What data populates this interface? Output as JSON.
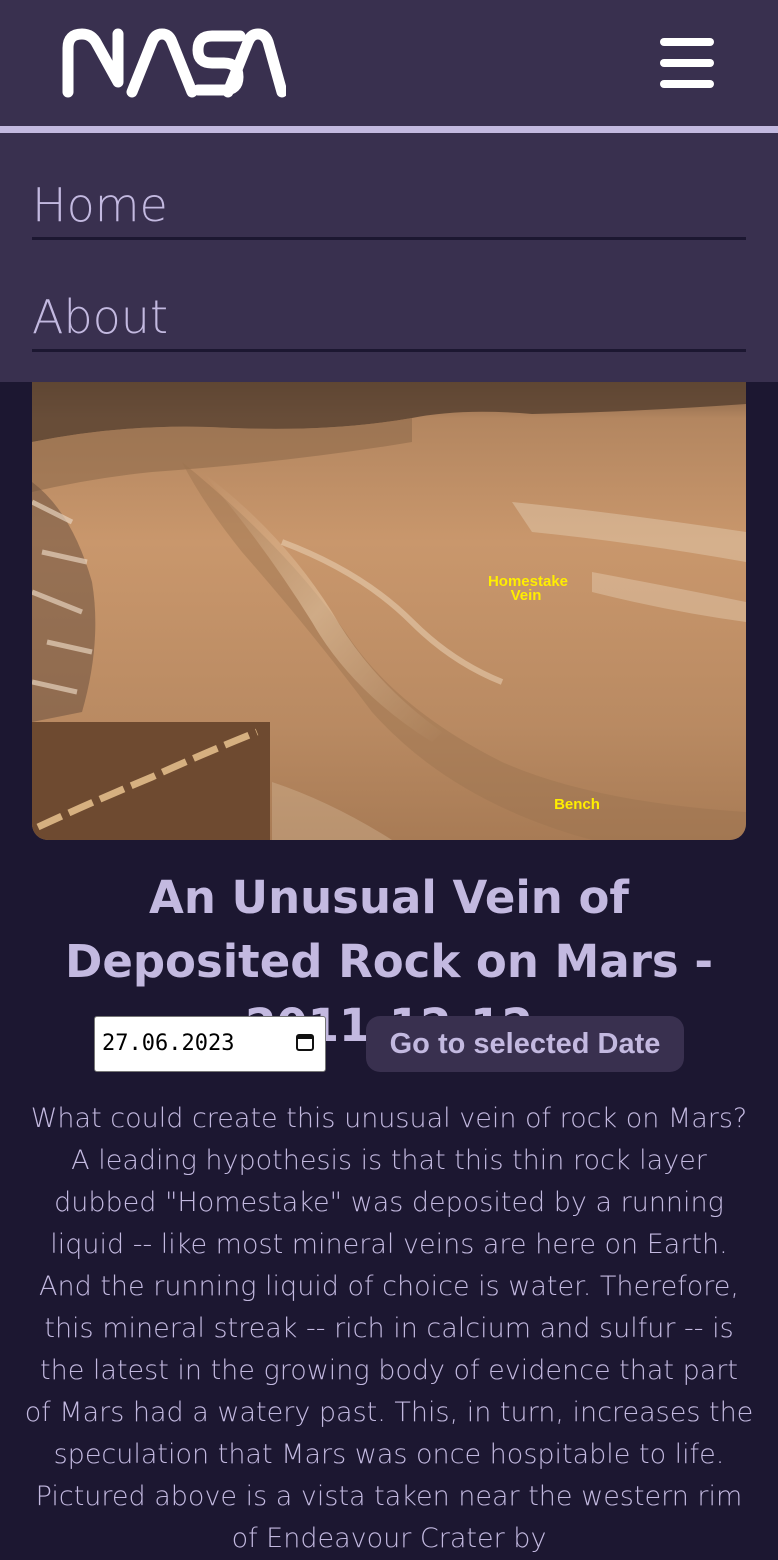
{
  "header": {
    "logo_text": "NASA",
    "menu_icon": "hamburger-menu-icon"
  },
  "nav": {
    "items": [
      {
        "label": "Home"
      },
      {
        "label": "About"
      }
    ]
  },
  "apod": {
    "image_labels": {
      "vein": "Homestake Vein",
      "bench": "Bench"
    },
    "title": "An Unusual Vein of Deposited Rock on Mars - 2011-12-12",
    "date_value": "27.06.2023",
    "date_icon": "calendar-icon",
    "go_button_label": "Go to selected Date",
    "explanation": "What could create this unusual vein of rock on Mars? A leading hypothesis is that this thin rock layer dubbed \"Homestake\" was deposited by a running liquid -- like most mineral veins are here on Earth. And the running liquid of choice is water. Therefore, this mineral streak -- rich in calcium and sulfur -- is the latest in the growing body of evidence that part of Mars had a watery past. This, in turn, increases the speculation that Mars was once hospitable to life. Pictured above is a vista taken near the western rim of Endeavour Crater by"
  },
  "colors": {
    "background": "#1c1731",
    "header": "#39304f",
    "accent_text": "#c3b9e0",
    "label_yellow": "#ffee00"
  }
}
